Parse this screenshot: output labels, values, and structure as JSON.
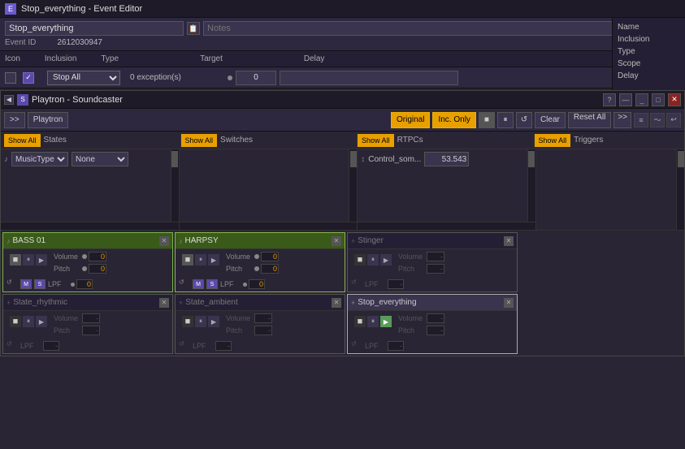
{
  "titlebar": {
    "title": "Stop_everything - Event Editor",
    "icon": "E"
  },
  "event": {
    "name": "Stop_everything",
    "id_label": "Event ID",
    "id_value": "2612030947",
    "notes_label": "Notes"
  },
  "props": {
    "icon_col": "Icon",
    "inclusion_col": "Inclusion",
    "type_col": "Type",
    "target_col": "Target",
    "delay_col": "Delay",
    "type_value": "Stop All",
    "target_value": "0 exception(s)",
    "delay_value": "0"
  },
  "right_panel": {
    "items": [
      "Name",
      "Inclusion",
      "Type",
      "Scope",
      "Delay"
    ]
  },
  "soundcaster": {
    "title": "Playtron - Soundcaster",
    "breadcrumb": "Playtron",
    "original_btn": "Original",
    "inc_only_btn": "Inc. Only",
    "clear_btn": "Clear",
    "reset_btn": "Reset All",
    "arrow_btn": ">>",
    "expand_btn": ">>"
  },
  "show_all": {
    "states_btn": "Show All",
    "states_label": "States",
    "switches_btn": "Show All",
    "switches_label": "Switches",
    "rtpcs_btn": "Show All",
    "rtpcs_label": "RTPCs",
    "triggers_btn": "Show All",
    "triggers_label": "Triggers"
  },
  "states_panel": {
    "icon": "♪",
    "dropdown": "MusicType",
    "value": "None"
  },
  "rtpc_panel": {
    "icon": "↕",
    "name": "Control_som...",
    "value": "53.543"
  },
  "cards": [
    {
      "id": "bass01",
      "title": "BASS 01",
      "type": "bass",
      "volume": "0",
      "pitch": "0",
      "lpf": "0",
      "has_m_s": true,
      "active": true,
      "dim": false
    },
    {
      "id": "harpsy",
      "title": "HARPSY",
      "type": "harpsy",
      "volume": "0",
      "pitch": "0",
      "lpf": "0",
      "has_m_s": true,
      "active": true,
      "dim": false
    },
    {
      "id": "stinger",
      "title": "Stinger",
      "type": "stinger",
      "volume": "-",
      "pitch": "-",
      "lpf": "-",
      "has_m_s": false,
      "active": false,
      "dim": true
    },
    {
      "id": "state-rhythmic",
      "title": "State_rhythmic",
      "type": "state",
      "volume": "-",
      "pitch": "-",
      "lpf": "-",
      "has_m_s": false,
      "active": false,
      "dim": true
    },
    {
      "id": "state-ambient",
      "title": "State_ambient",
      "type": "state",
      "volume": "-",
      "pitch": "-",
      "lpf": "-",
      "has_m_s": false,
      "active": false,
      "dim": true
    },
    {
      "id": "stop-everything",
      "title": "Stop_everything",
      "type": "stop",
      "volume": "-",
      "pitch": "-",
      "lpf": "-",
      "has_m_s": false,
      "active": false,
      "dim": true
    }
  ],
  "labels": {
    "volume": "Volume",
    "pitch": "Pitch",
    "lpf": "LPF",
    "m_btn": "M",
    "s_btn": "S"
  }
}
